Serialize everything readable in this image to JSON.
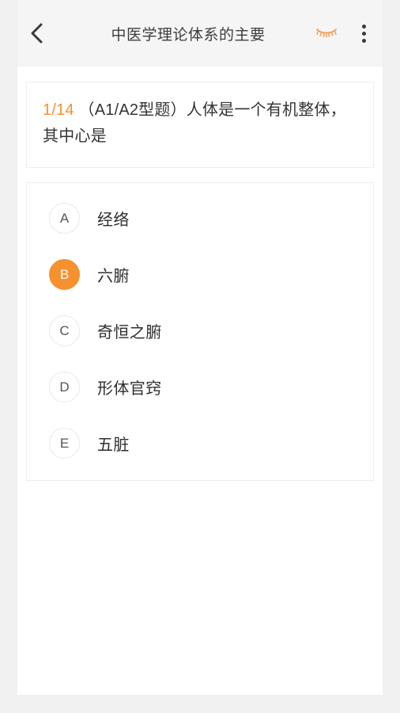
{
  "header": {
    "back_icon": "chevron-left-icon",
    "title": "中医学理论体系的主要",
    "eye_icon": "eye-closed-icon",
    "more_icon": "more-vertical-icon"
  },
  "question": {
    "index_label": "1/14",
    "text": "（A1/A2型题）人体是一个有机整体，其中心是"
  },
  "options": [
    {
      "key": "A",
      "label": "经络",
      "selected": false
    },
    {
      "key": "B",
      "label": "六腑",
      "selected": true
    },
    {
      "key": "C",
      "label": "奇恒之腑",
      "selected": false
    },
    {
      "key": "D",
      "label": "形体官窍",
      "selected": false
    },
    {
      "key": "E",
      "label": "五脏",
      "selected": false
    }
  ],
  "colors": {
    "accent": "#F5912E",
    "page_background": "#F0F0F0",
    "header_background": "#F5F5F6",
    "card_border": "#EDEDED",
    "text_primary": "#2E2E2E"
  }
}
